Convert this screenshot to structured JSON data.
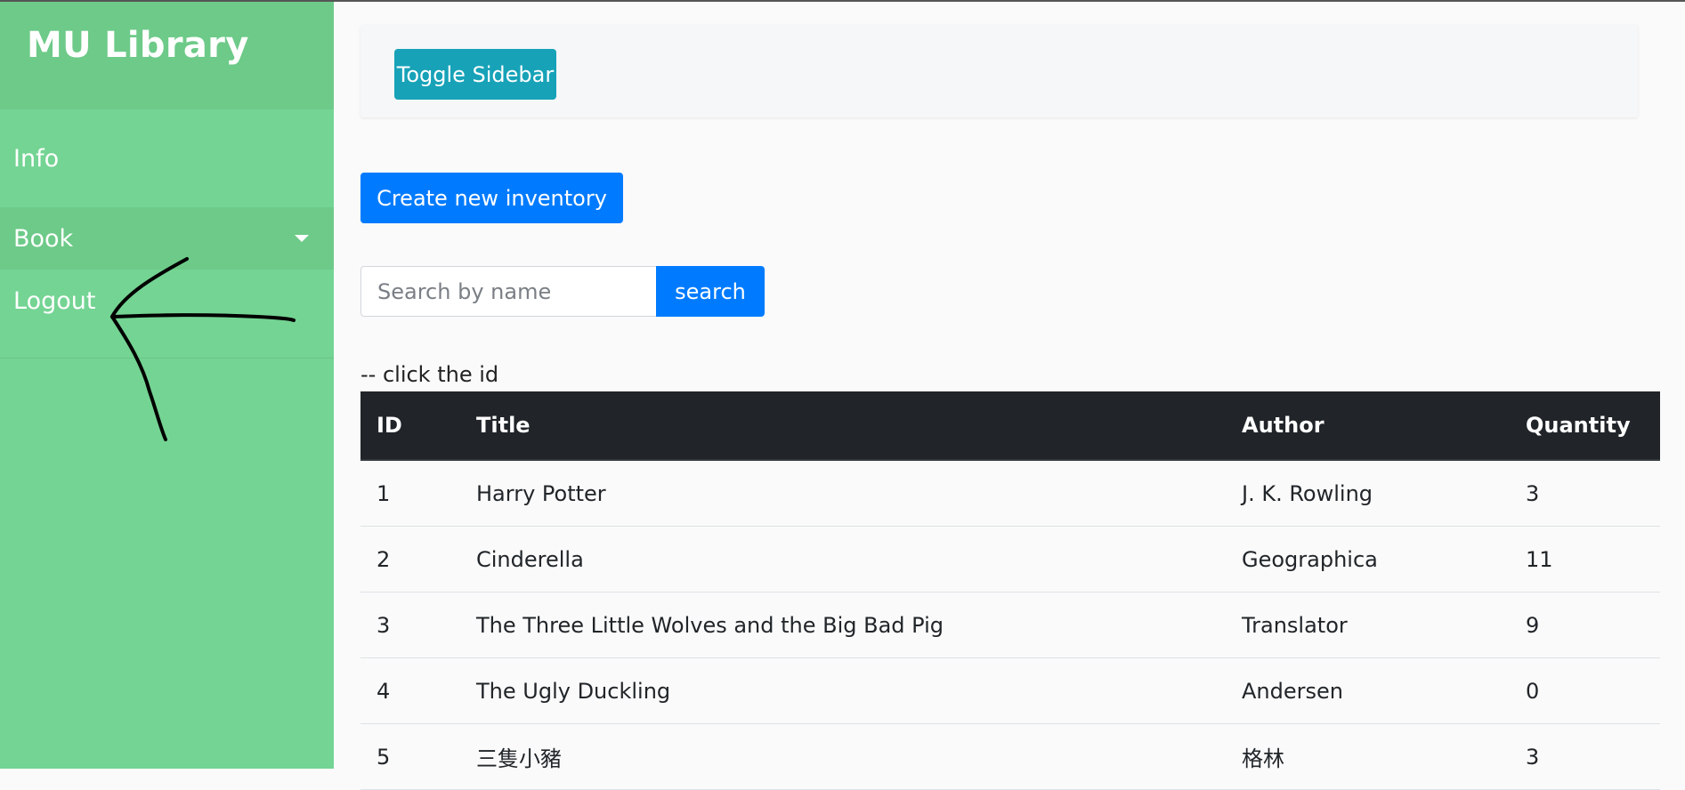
{
  "sidebar": {
    "brand": "MU Library",
    "items": [
      {
        "label": "Info"
      },
      {
        "label": "Book"
      },
      {
        "label": "Logout"
      }
    ]
  },
  "topbar": {
    "toggle_label": "Toggle Sidebar"
  },
  "main": {
    "create_label": "Create new inventory",
    "search_placeholder": "Search by name",
    "search_label": "search",
    "hint": "-- click the id"
  },
  "table": {
    "headers": [
      "ID",
      "Title",
      "Author",
      "Quantity"
    ],
    "rows": [
      [
        "1",
        "Harry Potter",
        "J. K. Rowling",
        "3"
      ],
      [
        "2",
        "Cinderella",
        "Geographica",
        "11"
      ],
      [
        "3",
        "The Three Little Wolves and the Big Bad Pig",
        "Translator",
        "9"
      ],
      [
        "4",
        "The Ugly Duckling",
        "Andersen",
        "0"
      ],
      [
        "5",
        "三隻小豬",
        "格林",
        "3"
      ]
    ]
  },
  "colors": {
    "sidebar_bg": "#74d493",
    "sidebar_header_bg": "#6dca88",
    "toggle_button": "#17a2b8",
    "primary_button": "#007bff",
    "table_header_bg": "#212529"
  }
}
